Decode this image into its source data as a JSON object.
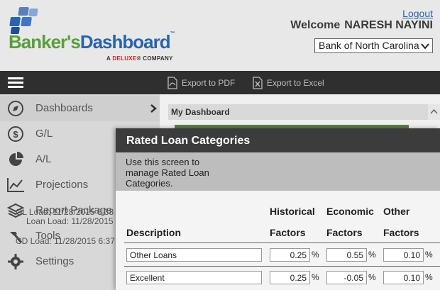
{
  "header": {
    "logo": {
      "brand_part1": "Banker's",
      "brand_part2": "Dashboard",
      "tm": "™",
      "sub_prefix": "A ",
      "sub_brand": "DELUXE",
      "sub_suffix": "® COMPANY"
    },
    "logout_label": "Logout",
    "welcome_label": "Welcome",
    "user_name": "NARESH NAYINI",
    "bank_selected": "Bank of North Carolina"
  },
  "toolbar": {
    "export_pdf_label": "Export to PDF",
    "export_excel_label": "Export to Excel"
  },
  "sidebar": {
    "items": [
      {
        "label": "Dashboards",
        "icon": "compass-icon"
      },
      {
        "label": "G/L",
        "icon": "dollar-icon"
      },
      {
        "label": "A/L",
        "icon": "pie-chart-icon"
      },
      {
        "label": "Projections",
        "icon": "line-chart-icon"
      },
      {
        "label": "Report Package",
        "icon": "layers-icon"
      },
      {
        "label": "Tools",
        "icon": "hammer-icon"
      },
      {
        "label": "Settings",
        "icon": "gear-icon"
      }
    ],
    "overlay_lines": [
      "GL Load: 11/28/2015 6:38",
      "Loan Load: 11/28/2015",
      "CD Load: 11/28/2015 6:37"
    ]
  },
  "dashboard": {
    "panel_title": "My Dashboard"
  },
  "modal": {
    "title": "Rated Loan Categories",
    "description": "Use this screen to manage Rated Loan Categories.",
    "columns": {
      "description": "Description",
      "historical_1": "Historical",
      "historical_2": "Factors",
      "economic_1": "Economic",
      "economic_2": "Factors",
      "other_1": "Other",
      "other_2": "Factors"
    },
    "percent_symbol": "%",
    "rows": [
      {
        "description": "Other Loans",
        "historical": "0.25",
        "economic": "0.55",
        "other": "0.10"
      },
      {
        "description": "Excellent",
        "historical": "0.25",
        "economic": "-0.05",
        "other": "0.10"
      }
    ]
  }
}
